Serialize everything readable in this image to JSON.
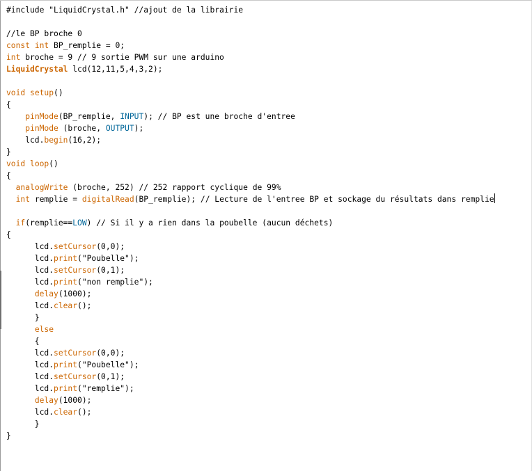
{
  "editor": {
    "language": "Arduino C++",
    "colors": {
      "keyword": "#cc6600",
      "constant": "#006699",
      "comment": "#7e7e7e",
      "text": "#000000",
      "background": "#ffffff"
    },
    "cursor_line": 16,
    "lines": [
      [
        {
          "t": "#include \"LiquidCrystal.h\" //ajout de la librairie",
          "c": ""
        }
      ],
      [],
      [
        {
          "t": "//le BP broche 0",
          "c": ""
        }
      ],
      [
        {
          "t": "const",
          "c": "typ"
        },
        {
          "t": " ",
          "c": ""
        },
        {
          "t": "int",
          "c": "typ"
        },
        {
          "t": " BP_remplie = 0;",
          "c": ""
        }
      ],
      [
        {
          "t": "int",
          "c": "typ"
        },
        {
          "t": " broche = 9 // 9 sortie PWM sur une arduino",
          "c": ""
        }
      ],
      [
        {
          "t": "LiquidCrystal",
          "c": "kwb"
        },
        {
          "t": " lcd(12,11,5,4,3,2);",
          "c": ""
        }
      ],
      [],
      [
        {
          "t": "void",
          "c": "typ"
        },
        {
          "t": " ",
          "c": ""
        },
        {
          "t": "setup",
          "c": "kw"
        },
        {
          "t": "()",
          "c": ""
        }
      ],
      [
        {
          "t": "{",
          "c": ""
        }
      ],
      [
        {
          "t": "    ",
          "c": ""
        },
        {
          "t": "pinMode",
          "c": "kw"
        },
        {
          "t": "(BP_remplie, ",
          "c": ""
        },
        {
          "t": "INPUT",
          "c": "lit"
        },
        {
          "t": "); // BP est une broche d'entree",
          "c": ""
        }
      ],
      [
        {
          "t": "    ",
          "c": ""
        },
        {
          "t": "pinMode",
          "c": "kw"
        },
        {
          "t": " (broche, ",
          "c": ""
        },
        {
          "t": "OUTPUT",
          "c": "lit"
        },
        {
          "t": ");",
          "c": ""
        }
      ],
      [
        {
          "t": "    lcd.",
          "c": ""
        },
        {
          "t": "begin",
          "c": "kw"
        },
        {
          "t": "(16,2);",
          "c": ""
        }
      ],
      [
        {
          "t": "}",
          "c": ""
        }
      ],
      [
        {
          "t": "void",
          "c": "typ"
        },
        {
          "t": " ",
          "c": ""
        },
        {
          "t": "loop",
          "c": "kw"
        },
        {
          "t": "()",
          "c": ""
        }
      ],
      [
        {
          "t": "{",
          "c": ""
        }
      ],
      [
        {
          "t": "  ",
          "c": ""
        },
        {
          "t": "analogWrite",
          "c": "kw"
        },
        {
          "t": " (broche, 252) // 252 rapport cyclique de 99%",
          "c": ""
        }
      ],
      [
        {
          "t": "  ",
          "c": ""
        },
        {
          "t": "int",
          "c": "typ"
        },
        {
          "t": " remplie = ",
          "c": ""
        },
        {
          "t": "digitalRead",
          "c": "kw"
        },
        {
          "t": "(BP_remplie); // Lecture de l'entree BP et sockage du résultats dans remplie",
          "c": ""
        }
      ],
      [],
      [
        {
          "t": "  ",
          "c": ""
        },
        {
          "t": "if",
          "c": "kw"
        },
        {
          "t": "(remplie==",
          "c": ""
        },
        {
          "t": "LOW",
          "c": "lit"
        },
        {
          "t": ") // Si il y a rien dans la poubelle (aucun déchets)",
          "c": ""
        }
      ],
      [
        {
          "t": "{",
          "c": ""
        }
      ],
      [
        {
          "t": "      lcd.",
          "c": ""
        },
        {
          "t": "setCursor",
          "c": "kw"
        },
        {
          "t": "(0,0);",
          "c": ""
        }
      ],
      [
        {
          "t": "      lcd.",
          "c": ""
        },
        {
          "t": "print",
          "c": "kw"
        },
        {
          "t": "(\"Poubelle\");",
          "c": ""
        }
      ],
      [
        {
          "t": "      lcd.",
          "c": ""
        },
        {
          "t": "setCursor",
          "c": "kw"
        },
        {
          "t": "(0,1);",
          "c": ""
        }
      ],
      [
        {
          "t": "      lcd.",
          "c": ""
        },
        {
          "t": "print",
          "c": "kw"
        },
        {
          "t": "(\"non remplie\");",
          "c": ""
        }
      ],
      [
        {
          "t": "      ",
          "c": ""
        },
        {
          "t": "delay",
          "c": "kw"
        },
        {
          "t": "(1000);",
          "c": ""
        }
      ],
      [
        {
          "t": "      lcd.",
          "c": ""
        },
        {
          "t": "clear",
          "c": "kw"
        },
        {
          "t": "();",
          "c": ""
        }
      ],
      [
        {
          "t": "      }",
          "c": ""
        }
      ],
      [
        {
          "t": "      ",
          "c": ""
        },
        {
          "t": "else",
          "c": "kw"
        }
      ],
      [
        {
          "t": "      {",
          "c": ""
        }
      ],
      [
        {
          "t": "      lcd.",
          "c": ""
        },
        {
          "t": "setCursor",
          "c": "kw"
        },
        {
          "t": "(0,0);",
          "c": ""
        }
      ],
      [
        {
          "t": "      lcd.",
          "c": ""
        },
        {
          "t": "print",
          "c": "kw"
        },
        {
          "t": "(\"Poubelle\");",
          "c": ""
        }
      ],
      [
        {
          "t": "      lcd.",
          "c": ""
        },
        {
          "t": "setCursor",
          "c": "kw"
        },
        {
          "t": "(0,1);",
          "c": ""
        }
      ],
      [
        {
          "t": "      lcd.",
          "c": ""
        },
        {
          "t": "print",
          "c": "kw"
        },
        {
          "t": "(\"remplie\");",
          "c": ""
        }
      ],
      [
        {
          "t": "      ",
          "c": ""
        },
        {
          "t": "delay",
          "c": "kw"
        },
        {
          "t": "(1000);",
          "c": ""
        }
      ],
      [
        {
          "t": "      lcd.",
          "c": ""
        },
        {
          "t": "clear",
          "c": "kw"
        },
        {
          "t": "();",
          "c": ""
        }
      ],
      [
        {
          "t": "      }",
          "c": ""
        }
      ],
      [
        {
          "t": "}",
          "c": ""
        }
      ]
    ]
  }
}
